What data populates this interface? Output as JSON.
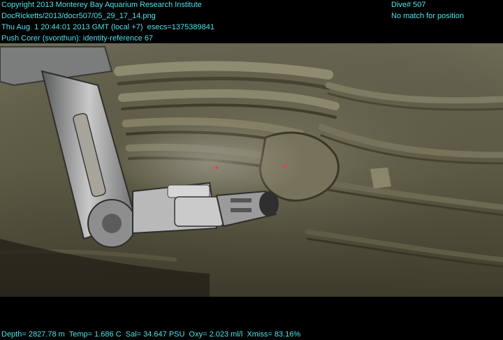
{
  "overlay": {
    "copyright": "Copyright 2013 Monterey Bay Aquarium Research Institute",
    "filename": "DocRicketts/2013/docr507/05_29_17_14.png",
    "timestamp": "Thu Aug  1 20:44:01 2013 GMT (local +7)  esecs=1375389841",
    "annotation": "Push Corer (svonthun): identity-reference 67",
    "dive": "Dive# 507",
    "position": "No match for position",
    "telemetry": "Depth= 2827.78 m  Temp= 1.686 C  Sal= 34.647 PSU  Oxy= 2.023 ml/l  Xmiss= 83.16%"
  },
  "colors": {
    "overlay_text": "#4fe3ea",
    "sediment": "#6f6a50",
    "laser": "#ff3a2a"
  }
}
